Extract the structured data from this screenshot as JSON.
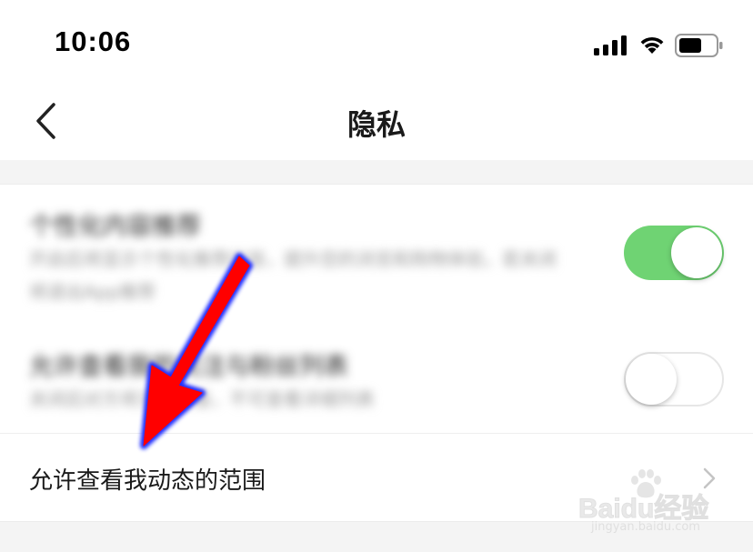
{
  "status_bar": {
    "time": "10:06",
    "icons": [
      "signal-icon",
      "wifi-icon",
      "battery-icon"
    ]
  },
  "nav": {
    "title": "隐私",
    "back_icon": "chevron-left-icon"
  },
  "settings": [
    {
      "title": "个性化内容推荐",
      "description": "开启后将显示个性化推荐内容，提升您的浏览和购物体验，若关闭将退出App推荐",
      "toggle": "on",
      "blurred": true
    },
    {
      "title": "允许查看我的关注与粉丝列表",
      "description": "关闭后对方将无法查看，不可查看详细列表",
      "toggle": "off",
      "blurred": true
    },
    {
      "label": "允许查看我动态的范围",
      "chevron_icon": "chevron-right-icon"
    }
  ],
  "colors": {
    "toggle_on": "#6fd373",
    "toggle_off_border": "#e6e6e6",
    "arrow_fill": "#ff0000",
    "arrow_outline": "#1a2cff",
    "section_gap": "#f4f4f4"
  },
  "annotation": {
    "type": "red-arrow",
    "points_to": "允许查看我动态的范围"
  },
  "watermark": {
    "brand": "Baidu经验",
    "url": "jingyan.baidu.com"
  }
}
